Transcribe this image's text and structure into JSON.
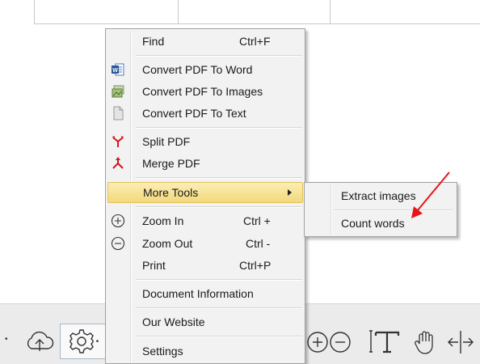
{
  "menu": {
    "items": [
      {
        "label": "Find",
        "shortcut": "Ctrl+F",
        "icon": "none"
      },
      {
        "label": "Convert PDF To Word",
        "icon": "word-icon"
      },
      {
        "label": "Convert PDF To Images",
        "icon": "images-icon"
      },
      {
        "label": "Convert PDF To Text",
        "icon": "text-document-icon"
      },
      {
        "label": "Split PDF",
        "icon": "split-icon"
      },
      {
        "label": "Merge PDF",
        "icon": "merge-icon"
      },
      {
        "label": "More Tools",
        "icon": "none",
        "has_submenu": true,
        "highlighted": true
      },
      {
        "label": "Zoom In",
        "shortcut": "Ctrl +",
        "icon": "zoom-in-icon"
      },
      {
        "label": "Zoom Out",
        "shortcut": "Ctrl -",
        "icon": "zoom-out-icon"
      },
      {
        "label": "Print",
        "shortcut": "Ctrl+P",
        "icon": "none"
      },
      {
        "label": "Document Information",
        "icon": "none"
      },
      {
        "label": "Our Website",
        "icon": "none"
      },
      {
        "label": "Settings",
        "icon": "none"
      }
    ]
  },
  "submenu": {
    "items": [
      {
        "label": "Extract images"
      },
      {
        "label": "Count words"
      }
    ]
  },
  "toolbar": {
    "buttons": [
      "cloud-upload-icon",
      "gear-icon",
      "zoom-in-icon",
      "zoom-out-icon",
      "text-select-icon",
      "hand-pan-icon",
      "fit-width-icon"
    ]
  },
  "colors": {
    "highlight": "#f6dc84",
    "annotation_arrow": "#e8141c",
    "menu_background": "#f2f2f2"
  }
}
